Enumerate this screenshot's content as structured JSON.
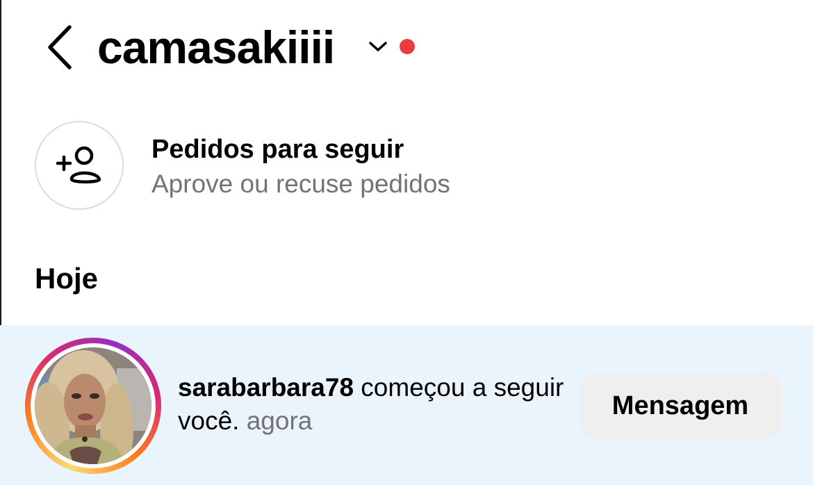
{
  "colors": {
    "background": "#ffffff",
    "highlight_background": "#e9f4fd",
    "notification_dot": "#ed3a3d",
    "secondary_text": "#737373",
    "button_background": "#efefef"
  },
  "header": {
    "back_icon": "chevron-left-icon",
    "account_name": "camasakiiii",
    "switch_icon": "chevron-down-icon",
    "has_unread_dot": true
  },
  "follow_requests": {
    "icon": "add-person-icon",
    "title": "Pedidos para seguir",
    "subtitle": "Aprove ou recuse pedidos"
  },
  "sections": [
    {
      "title": "Hoje",
      "notifications": [
        {
          "username": "sarabarbara78",
          "action_text": " começou a seguir você.",
          "timestamp": " agora",
          "avatar": "profile-photo-with-story-ring",
          "button_label": "Mensagem"
        }
      ]
    }
  ]
}
